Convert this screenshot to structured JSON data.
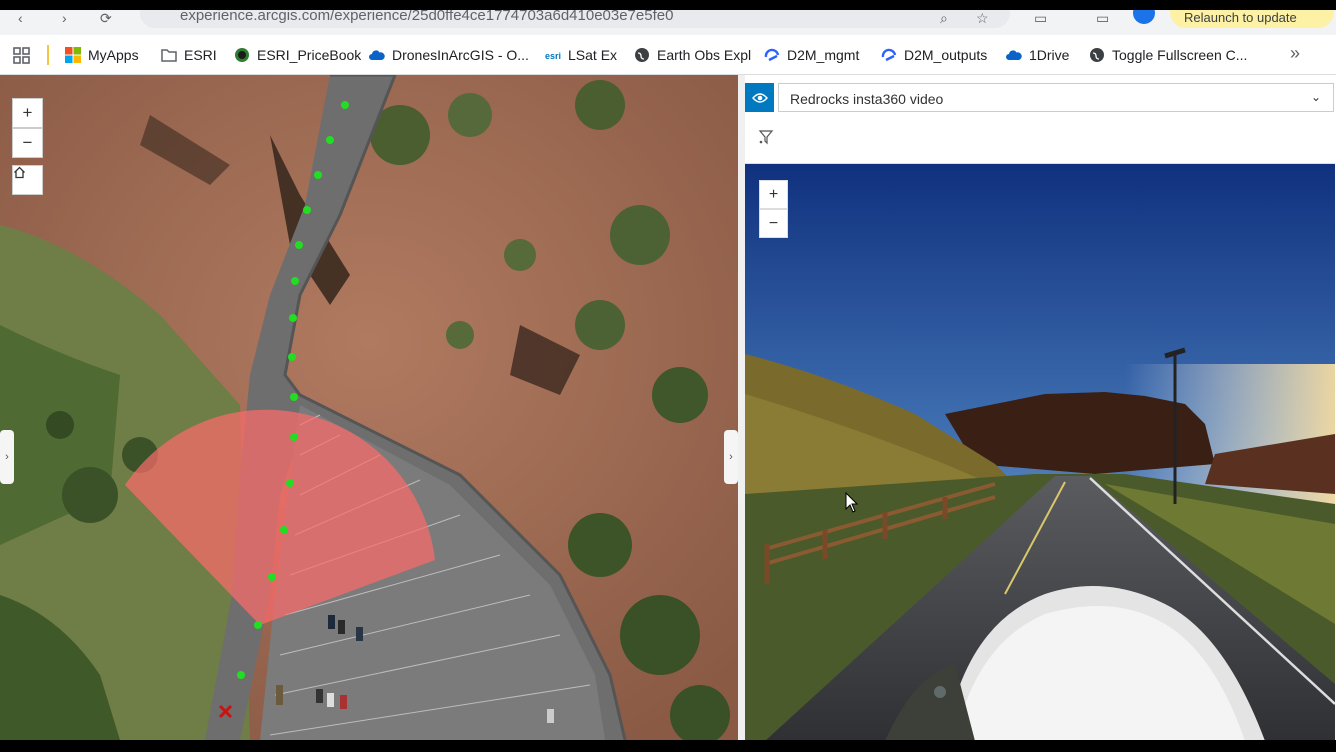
{
  "browser": {
    "url": "experience.arcgis.com/experience/25d0ffe4ce1774703a6d410e03e7e5fe0",
    "reload_label": "Relaunch to update",
    "bookmarks": [
      {
        "label": "MyApps",
        "icon": "microsoft-icon"
      },
      {
        "label": "ESRI",
        "icon": "folder-icon"
      },
      {
        "label": "ESRI_PriceBook",
        "icon": "globe-icon"
      },
      {
        "label": "DronesInArcGIS - O...",
        "icon": "cloud-icon"
      },
      {
        "label": "LSat Ex",
        "icon": "esri-logo-icon"
      },
      {
        "label": "Earth Obs Expl",
        "icon": "globe-icon"
      },
      {
        "label": "D2M_mgmt",
        "icon": "arcgis-icon"
      },
      {
        "label": "D2M_outputs",
        "icon": "arcgis-icon"
      },
      {
        "label": "1Drive",
        "icon": "cloud-icon"
      },
      {
        "label": "Toggle Fullscreen C...",
        "icon": "globe-icon"
      }
    ]
  },
  "map": {
    "zoom_in": "+",
    "zoom_out": "−",
    "home_icon": "home-icon",
    "expand_left": "›",
    "expand_right": "›",
    "track_color": "#22dd22",
    "fov_color": "#ff6b6b",
    "marker_color": "#cc1111"
  },
  "panel": {
    "layer_name": "Redrocks insta360 video",
    "accent": "#0079c1",
    "video_zoom_in": "+",
    "video_zoom_out": "−"
  }
}
